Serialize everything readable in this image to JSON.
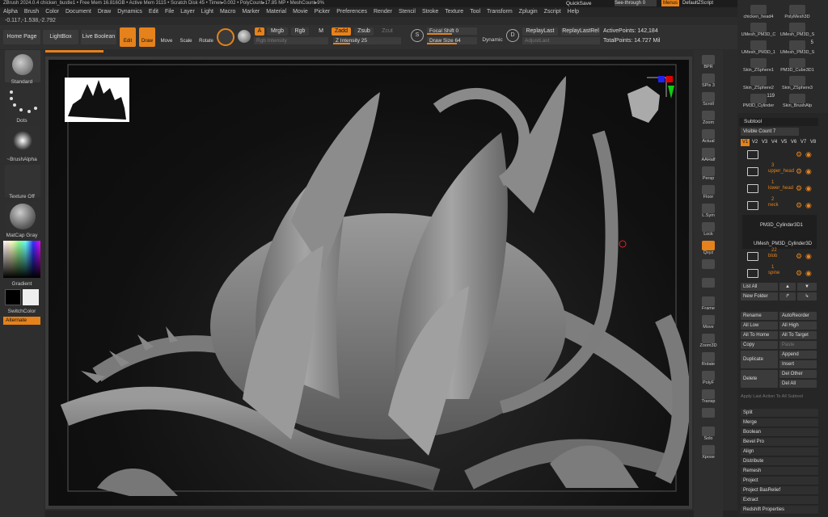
{
  "app": {
    "title_bar": "ZBrush 2024.0.4    chicken_bustle1  •  Free Mem 16.816GB  •  Active Mem 3115  •  Scratch Disk 45  •  Timer▸0.002  •  PolyCount▸17.85 MP  •  MeshCount▸9%",
    "coords": "-0.117,-1.538,-2.792"
  },
  "menubar": [
    "Alpha",
    "Brush",
    "Color",
    "Document",
    "Draw",
    "Dynamics",
    "Edit",
    "File",
    "Layer",
    "Light",
    "Macro",
    "Marker",
    "Material",
    "Movie",
    "Picker",
    "Preferences",
    "Render",
    "Stencil",
    "Stroke",
    "Texture",
    "Tool",
    "Transform",
    "Zplugin",
    "Zscript",
    "Help"
  ],
  "topright": {
    "quicksave": "QuickSave",
    "seethrough": "See-through  0",
    "menus": "Menus",
    "default_zscript": "DefaultZScript"
  },
  "toolbar": {
    "home_page": "Home Page",
    "lightbox": "LightBox",
    "live_boolean": "Live Boolean",
    "edit": "Edit",
    "draw": "Draw",
    "move": "Move",
    "scale": "Scale",
    "rotate": "Rotate",
    "a": "A",
    "mrgb": "Mrgb",
    "rgb": "Rgb",
    "m": "M",
    "zadd": "Zadd",
    "zsub": "Zsub",
    "zcut": "Zcut",
    "rgb_intensity": "Rgb Intensity",
    "z_intensity_label": "Z Intensity",
    "z_intensity_value": "25",
    "focal_shift_label": "Focal Shift",
    "focal_shift_value": "0",
    "draw_size_label": "Draw Size",
    "draw_size_value": "64",
    "dynamic": "Dynamic",
    "replay_last": "ReplayLast",
    "replay_last_rel": "ReplayLastRel",
    "adjust_last": "AdjustLast",
    "active_points": "ActivePoints: 142,184",
    "total_points": "TotalPoints: 14.727 Mil"
  },
  "left_shelf": {
    "standard": "Standard",
    "dots": "Dots",
    "brush_alpha": "~BrushAlpha",
    "texture_off": "Texture Off",
    "matcap_gray": "MatCap Gray",
    "gradient": "Gradient",
    "switch_color": "SwitchColor",
    "alternate": "Alternate"
  },
  "right_shelf": [
    {
      "label": "BPR",
      "icon": "bpr-icon"
    },
    {
      "label": "SPix 3",
      "icon": "spix-icon"
    },
    {
      "label": "Scroll",
      "icon": "scroll-icon"
    },
    {
      "label": "Zoom",
      "icon": "zoom-icon"
    },
    {
      "label": "Actual",
      "icon": "actual-icon"
    },
    {
      "label": "AAHalf",
      "icon": "aahalf-icon"
    },
    {
      "label": "Persp",
      "icon": "persp-icon"
    },
    {
      "label": "Floor",
      "icon": "floor-icon"
    },
    {
      "label": "L.Sym",
      "icon": "lsym-icon"
    },
    {
      "label": "Lock",
      "icon": "lock-icon"
    },
    {
      "label": "Qxyz",
      "icon": "xyz-icon"
    },
    {
      "label": "",
      "icon": "rotate-y-icon"
    },
    {
      "label": "",
      "icon": "rotate-z-icon"
    },
    {
      "label": "Frame",
      "icon": "frame-icon"
    },
    {
      "label": "Move",
      "icon": "move-icon"
    },
    {
      "label": "Zoom3D",
      "icon": "zoom3d-icon"
    },
    {
      "label": "Rotate",
      "icon": "rotate-icon"
    },
    {
      "label": "PolyF",
      "icon": "polyf-icon"
    },
    {
      "label": "Transp",
      "icon": "transp-icon"
    },
    {
      "label": "",
      "icon": "ghost-icon"
    },
    {
      "label": "Solo",
      "icon": "solo-icon"
    },
    {
      "label": "Xpose",
      "icon": "xpose-icon"
    }
  ],
  "tool_palette": {
    "tools": [
      {
        "name": "chicken_head4"
      },
      {
        "name": "PolyMesh3D"
      },
      {
        "name": "UMesh_PM3D_C"
      },
      {
        "name": "UMesh_PM3D_S"
      },
      {
        "name": "UMesh_PM3D_1"
      },
      {
        "name": "UMesh_PM3D_S",
        "count": "5"
      },
      {
        "name": "Skin_ZSphere1"
      },
      {
        "name": "PM3D_Cube3D1"
      },
      {
        "name": "Skin_ZSphere2"
      },
      {
        "name": "Skin_ZSphere3"
      },
      {
        "name": "PM3D_Cylinder",
        "count": "119"
      },
      {
        "name": "Skin_BrushAlp"
      }
    ]
  },
  "subtool": {
    "title": "Subtool",
    "visible_count_label": "Visible Count",
    "visible_count_value": "7",
    "tabs": [
      "V1",
      "V2",
      "V3",
      "V4",
      "V5",
      "V6",
      "V7",
      "V8"
    ],
    "items": [
      {
        "count": "",
        "name": ""
      },
      {
        "count": "3",
        "name": "upper_head"
      },
      {
        "count": "1",
        "name": "lower_head"
      },
      {
        "count": "2",
        "name": "neck"
      },
      {
        "count": "",
        "name": "PM3D_Cylinder3D1"
      },
      {
        "count": "",
        "name": "UMesh_PM3D_Cylinder3D"
      },
      {
        "count": "22",
        "name": "blob"
      },
      {
        "count": "1",
        "name": "spine"
      }
    ],
    "list_all": "List All",
    "new_folder": "New Folder",
    "rename": "Rename",
    "auto_reorder": "AutoReorder",
    "all_low": "All Low",
    "all_high": "All High",
    "all_to_home": "All To Home",
    "all_to_target": "All To Target",
    "copy": "Copy",
    "paste": "Paste",
    "duplicate": "Duplicate",
    "append": "Append",
    "insert": "Insert",
    "delete": "Delete",
    "del_other": "Del Other",
    "del_all": "Del All",
    "apply_last": "Apply Last Action To All Subtool",
    "sections": [
      "Split",
      "Merge",
      "Boolean",
      "Bevel Pro",
      "Align",
      "Distribute",
      "Remesh",
      "Project",
      "Project BasRelief",
      "Extract",
      "Redshift Properties"
    ]
  },
  "colors": {
    "accent": "#e5821c",
    "panel": "#2e2e2e",
    "viewport_bg": "#101010",
    "mesh": "#8a8a8a"
  }
}
